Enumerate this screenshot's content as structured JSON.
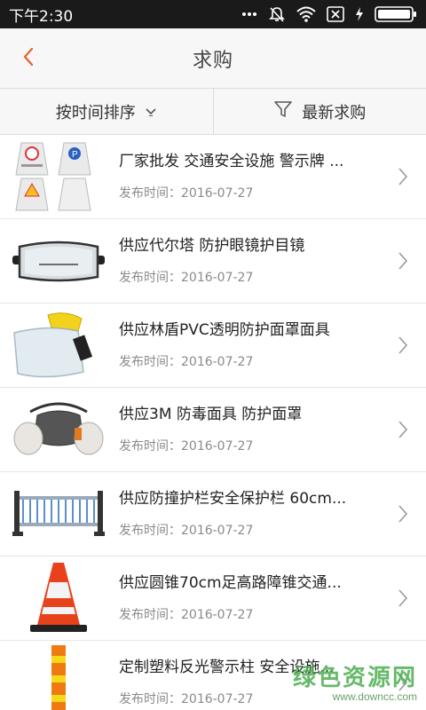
{
  "status_bar": {
    "time": "下午2:30",
    "icons": [
      "more-dots-icon",
      "mute-icon",
      "wifi-icon",
      "sim-off-icon",
      "charging-icon",
      "battery-icon"
    ]
  },
  "header": {
    "title": "求购",
    "back_icon": "chevron-left-icon",
    "accent_color": "#e8602c"
  },
  "filters": {
    "sort_label": "按时间排序",
    "latest_label": "最新求购"
  },
  "items": [
    {
      "title": "厂家批发 交通安全设施 警示牌 ...",
      "date": "发布时间：2016-07-27",
      "image": "warning-signs"
    },
    {
      "title": "供应代尔塔 防护眼镜护目镜",
      "date": "发布时间：2016-07-27",
      "image": "safety-goggles"
    },
    {
      "title": "供应林盾PVC透明防护面罩面具",
      "date": "发布时间：2016-07-27",
      "image": "face-shield"
    },
    {
      "title": "供应3M 防毒面具  防护面罩",
      "date": "发布时间：2016-07-27",
      "image": "gas-mask"
    },
    {
      "title": "供应防撞护栏安全保护栏 60cm...",
      "date": "发布时间：2016-07-27",
      "image": "guardrail"
    },
    {
      "title": "供应圆锥70cm足高路障锥交通...",
      "date": "发布时间：2016-07-27",
      "image": "traffic-cone"
    },
    {
      "title": "定制塑料反光警示柱  安全设施...",
      "date": "发布时间：2016-07-27",
      "image": "warning-post"
    }
  ],
  "watermark": {
    "text": "绿色资源网",
    "url": "www.downcc.com"
  }
}
